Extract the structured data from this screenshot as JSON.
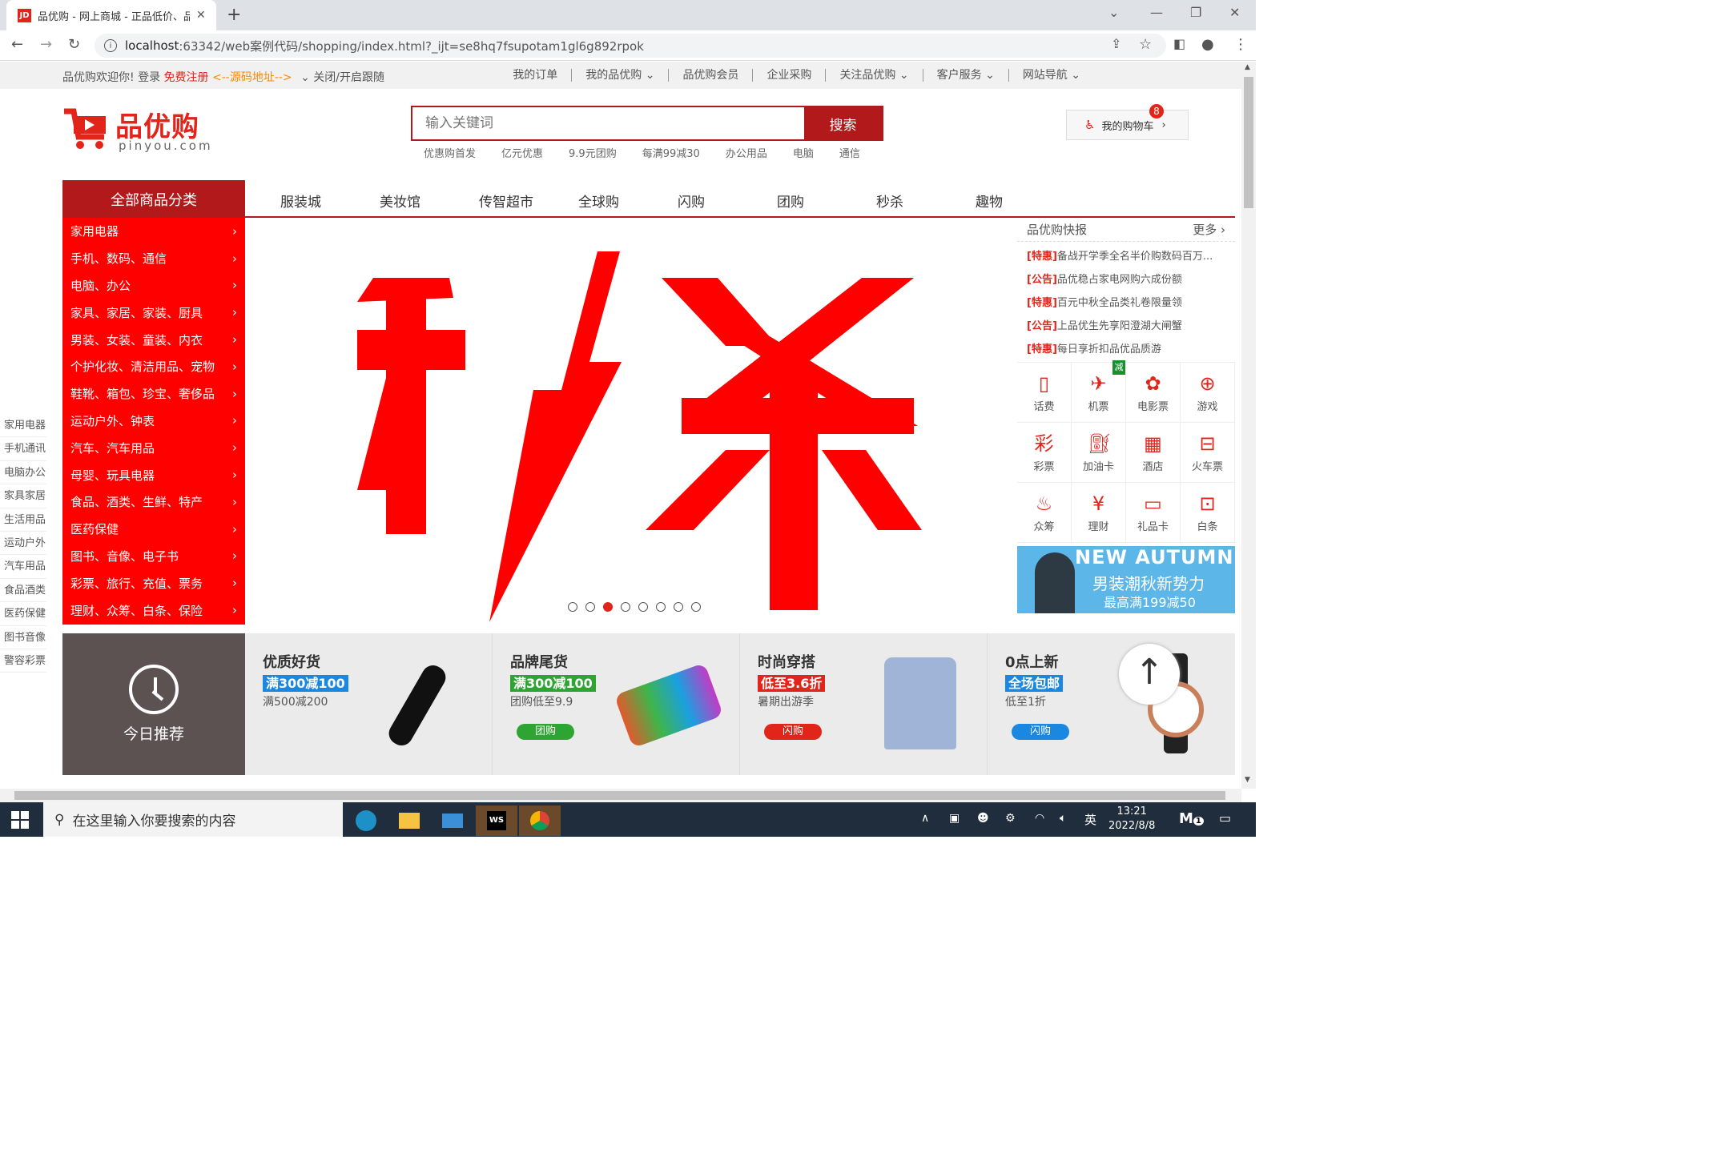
{
  "browser": {
    "tab_title": "品优购 - 网上商城 - 正品低价、品质保障",
    "favicon": "JD",
    "url_host": "localhost",
    "url_rest": ":63342/web案例代码/shopping/index.html?_ijt=se8hq7fsupotam1gl6g892rpok"
  },
  "shortcut": {
    "welcome": "品优购欢迎你!",
    "login": "登录",
    "register": "免费注册",
    "source": "<--源码地址-->",
    "toggle": "关闭/开启跟随",
    "links": [
      "我的订单",
      "我的品优购",
      "品优购会员",
      "企业采购",
      "关注品优购",
      "客户服务",
      "网站导航"
    ]
  },
  "logo": {
    "name": "品优购",
    "domain": "pinyou.com"
  },
  "search": {
    "placeholder": "输入关键词",
    "button": "搜索",
    "hotwords": [
      "优惠购首发",
      "亿元优惠",
      "9.9元团购",
      "每满99减30",
      "办公用品",
      "电脑",
      "通信"
    ]
  },
  "cart": {
    "label": "我的购物车",
    "count": "8"
  },
  "nav": {
    "all_categories": "全部商品分类",
    "items": [
      "服装城",
      "美妆馆",
      "传智超市",
      "全球购",
      "闪购",
      "团购",
      "秒杀",
      "趣物"
    ]
  },
  "categories": [
    "家用电器",
    "手机、数码、通信",
    "电脑、办公",
    "家具、家居、家装、厨具",
    "男装、女装、童装、内衣",
    "个护化妆、清洁用品、宠物",
    "鞋靴、箱包、珍宝、奢侈品",
    "运动户外、钟表",
    "汽车、汽车用品",
    "母婴、玩具电器",
    "食品、酒类、生鲜、特产",
    "医药保健",
    "图书、音像、电子书",
    "彩票、旅行、充值、票务",
    "理财、众筹、白条、保险"
  ],
  "fixedtool": [
    "家用电器",
    "手机通讯",
    "电脑办公",
    "家具家居",
    "生活用品",
    "运动户外",
    "汽车用品",
    "食品酒类",
    "医药保健",
    "图书音像",
    "警容彩票"
  ],
  "banner": {
    "text": "秒杀",
    "active_dot": 3,
    "dot_count": 8
  },
  "news": {
    "title": "品优购快报",
    "more": "更多",
    "items": [
      {
        "tag": "[特惠]",
        "text": "备战开学季全名半价购数码百万..."
      },
      {
        "tag": "[公告]",
        "text": "品优稳占家电网购六成份额"
      },
      {
        "tag": "[特惠]",
        "text": "百元中秋全品类礼卷限量领"
      },
      {
        "tag": "[公告]",
        "text": "上品优生先享阳澄湖大闸蟹"
      },
      {
        "tag": "[特惠]",
        "text": "每日享折扣品优品质游"
      }
    ]
  },
  "lifeservices": [
    {
      "label": "话费",
      "icon": "phone-icon"
    },
    {
      "label": "机票",
      "icon": "plane-icon"
    },
    {
      "label": "电影票",
      "icon": "film-icon"
    },
    {
      "label": "游戏",
      "icon": "gamepad-icon"
    },
    {
      "label": "彩票",
      "icon": "lottery-icon"
    },
    {
      "label": "加油卡",
      "icon": "gas-icon"
    },
    {
      "label": "酒店",
      "icon": "hotel-icon"
    },
    {
      "label": "火车票",
      "icon": "train-icon"
    },
    {
      "label": "众筹",
      "icon": "crowdfund-icon"
    },
    {
      "label": "理财",
      "icon": "yen-icon"
    },
    {
      "label": "礼品卡",
      "icon": "giftcard-icon"
    },
    {
      "label": "白条",
      "icon": "note-icon"
    }
  ],
  "plane_badge": "减",
  "ad": {
    "line1": "NEW AUTUMN",
    "line2": "男装潮秋新势力",
    "line3": "最高满199减50"
  },
  "recommend": {
    "today": "今日推荐",
    "items": [
      {
        "title": "优质好货",
        "tag": "满300减100",
        "tag_color": "#1a88e0",
        "sub": "满500减200",
        "btn": "",
        "btn_color": ""
      },
      {
        "title": "品牌尾货",
        "tag": "满300减100",
        "tag_color": "#2ea532",
        "sub": "团购低至9.9",
        "btn": "团购",
        "btn_color": "#2ea532"
      },
      {
        "title": "时尚穿搭",
        "tag": "低至3.6折",
        "tag_color": "#e1251b",
        "sub": "暑期出游季",
        "btn": "闪购",
        "btn_color": "#e1251b"
      },
      {
        "title": "0点上新",
        "tag": "全场包邮",
        "tag_color": "#1a88e0",
        "sub": "低至1折",
        "btn": "闪购",
        "btn_color": "#1a88e0"
      }
    ]
  },
  "taskbar": {
    "search_placeholder": "在这里输入你要搜索的内容",
    "lang": "英",
    "time": "13:21",
    "date": "2022/8/8",
    "notify_count": "1"
  }
}
